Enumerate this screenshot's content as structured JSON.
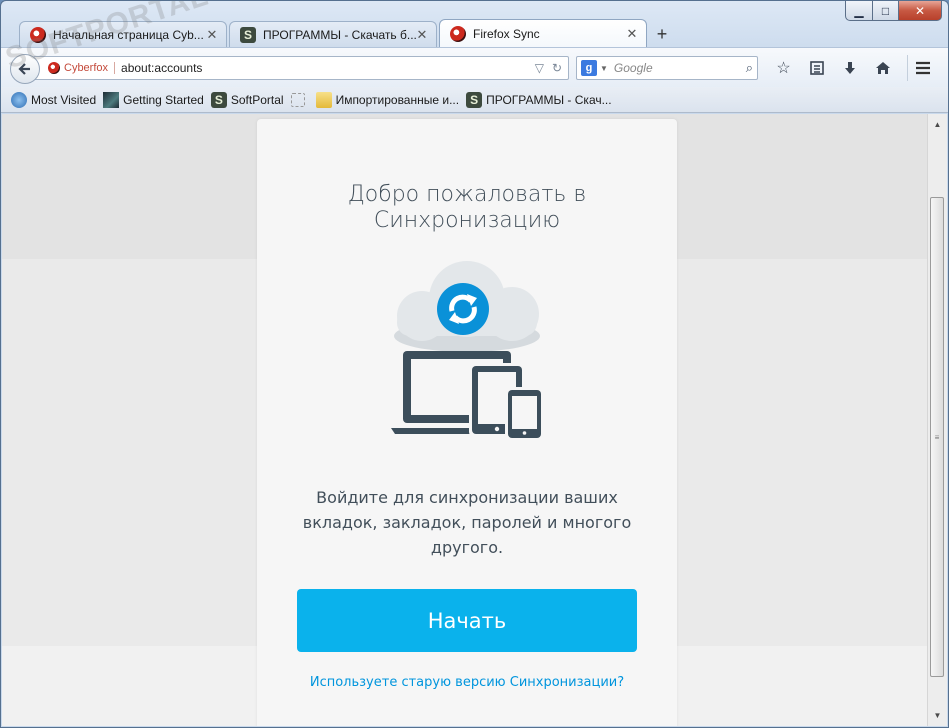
{
  "window": {
    "controls": {
      "minimize": "▁",
      "maximize": "□",
      "close": "✕"
    }
  },
  "tabs": [
    {
      "title": "Начальная страница Cyb...",
      "icon": "cyberfox-logo",
      "active": false
    },
    {
      "title": "ПРОГРАММЫ - Скачать б...",
      "icon": "softportal-logo",
      "active": false
    },
    {
      "title": "Firefox Sync",
      "icon": "cyberfox-logo",
      "active": true
    }
  ],
  "tab_close_glyph": "✕",
  "new_tab_glyph": "+",
  "softportal_icon_letter": "S",
  "watermark": "SOFTPORTAL",
  "navbar": {
    "identity_label": "Cyberfox",
    "url": "about:accounts",
    "search_engine_letter": "g",
    "search_placeholder": "Google"
  },
  "bookmarks": [
    {
      "label": "Most Visited",
      "icon": "most-visited-icon"
    },
    {
      "label": "Getting Started",
      "icon": "getting-started-icon"
    },
    {
      "label": "SoftPortal",
      "icon": "softportal-logo"
    },
    {
      "label": "",
      "icon": "empty-bookmark-icon"
    },
    {
      "label": "Импортированные и...",
      "icon": "folder-icon"
    },
    {
      "label": "ПРОГРАММЫ - Скач...",
      "icon": "softportal-logo"
    }
  ],
  "page": {
    "title_line1": "Добро пожаловать в",
    "title_line2": "Синхронизацию",
    "desc_line1": "Войдите для синхронизации ваших",
    "desc_line2": "вкладок, закладок, паролей и многого",
    "desc_line3": "другого.",
    "start_button": "Начать",
    "old_sync_link": "Используете старую версию Синхронизации?"
  },
  "colors": {
    "accent": "#0ab2ec",
    "link": "#0095dd",
    "device": "#3c4e5b",
    "cloud": "#e3e7ea",
    "sync_icon": "#0a91d8"
  }
}
